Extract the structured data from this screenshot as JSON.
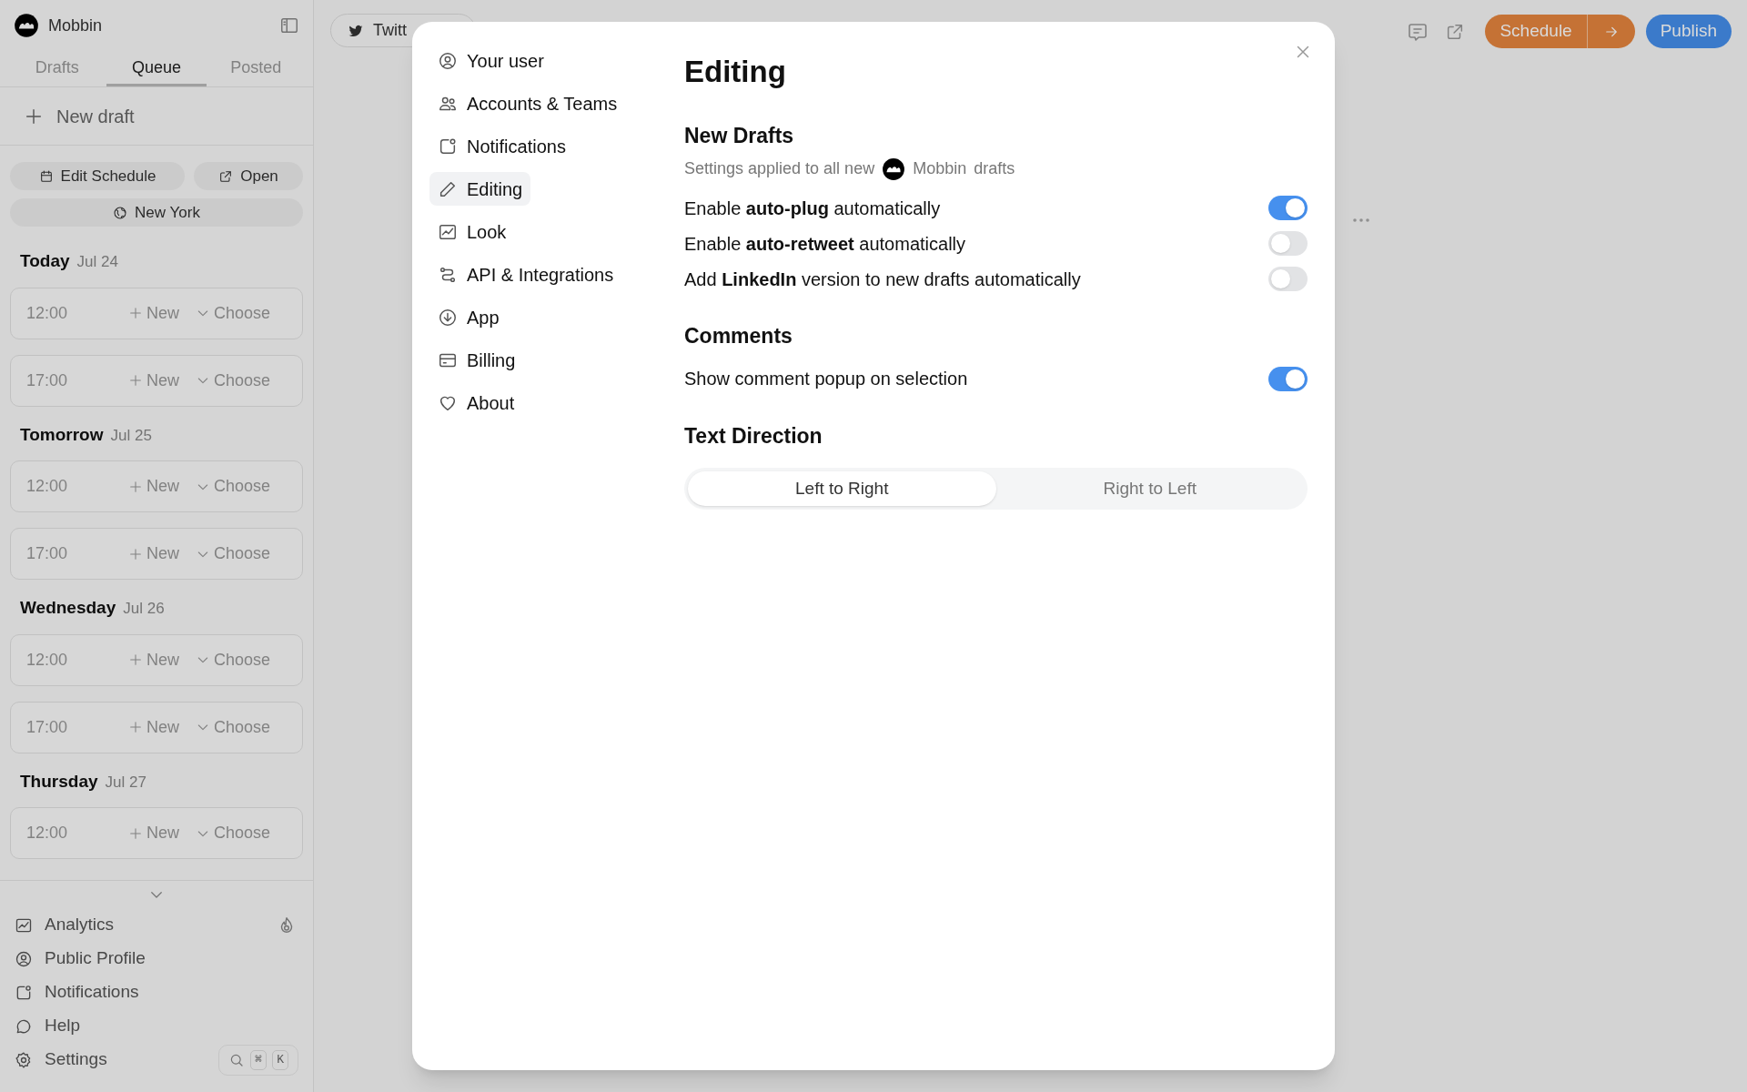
{
  "sidebar": {
    "brand": "Mobbin",
    "tabs": [
      {
        "label": "Drafts",
        "selected": false
      },
      {
        "label": "Queue",
        "selected": true
      },
      {
        "label": "Posted",
        "selected": false
      }
    ],
    "new_draft": "New draft",
    "buttons": [
      "Edit Schedule",
      "Open"
    ],
    "timezone": "New York",
    "days": [
      {
        "label": "Today",
        "date": "Jul 24",
        "slots": [
          {
            "time": "12:00",
            "new": "New",
            "choose": "Choose"
          },
          {
            "time": "17:00",
            "new": "New",
            "choose": "Choose"
          }
        ]
      },
      {
        "label": "Tomorrow",
        "date": "Jul 25",
        "slots": [
          {
            "time": "12:00",
            "new": "New",
            "choose": "Choose"
          },
          {
            "time": "17:00",
            "new": "New",
            "choose": "Choose"
          }
        ]
      },
      {
        "label": "Wednesday",
        "date": "Jul 26",
        "slots": [
          {
            "time": "12:00",
            "new": "New",
            "choose": "Choose"
          },
          {
            "time": "17:00",
            "new": "New",
            "choose": "Choose"
          }
        ]
      },
      {
        "label": "Thursday",
        "date": "Jul 27",
        "slots": [
          {
            "time": "12:00",
            "new": "New",
            "choose": "Choose"
          }
        ]
      }
    ],
    "menu": [
      "Analytics",
      "Public Profile",
      "Notifications",
      "Help",
      "Settings"
    ],
    "shortcut_keys": [
      "⌘",
      "K"
    ]
  },
  "editor": {
    "account_tab": "Twitt",
    "schedule": "Schedule",
    "publish": "Publish"
  },
  "settings": {
    "nav": [
      {
        "label": "Your user",
        "selected": false
      },
      {
        "label": "Accounts & Teams",
        "selected": false
      },
      {
        "label": "Notifications",
        "selected": false
      },
      {
        "label": "Editing",
        "selected": true
      },
      {
        "label": "Look",
        "selected": false
      },
      {
        "label": "API & Integrations",
        "selected": false
      },
      {
        "label": "App",
        "selected": false
      },
      {
        "label": "Billing",
        "selected": false
      },
      {
        "label": "About",
        "selected": false
      }
    ],
    "title": "Editing",
    "sections": [
      {
        "kind": "toggles",
        "title": "New Drafts",
        "subtitle": {
          "prefix": "Settings applied to all new",
          "workspace": "Mobbin",
          "suffix": "drafts"
        },
        "options": [
          {
            "label": "Enable **auto-plug** automatically",
            "on": true
          },
          {
            "label": "Enable **auto-retweet** automatically",
            "on": false
          },
          {
            "label": "Add **LinkedIn** version to new drafts automatically",
            "on": false
          }
        ]
      },
      {
        "kind": "toggles",
        "title": "Comments",
        "options": [
          {
            "label": "Show comment popup on selection",
            "on": true
          }
        ]
      },
      {
        "kind": "segmented",
        "title": "Text Direction",
        "options": [
          {
            "label": "Left to Right",
            "selected": true
          },
          {
            "label": "Right to Left",
            "selected": false
          }
        ]
      }
    ]
  }
}
